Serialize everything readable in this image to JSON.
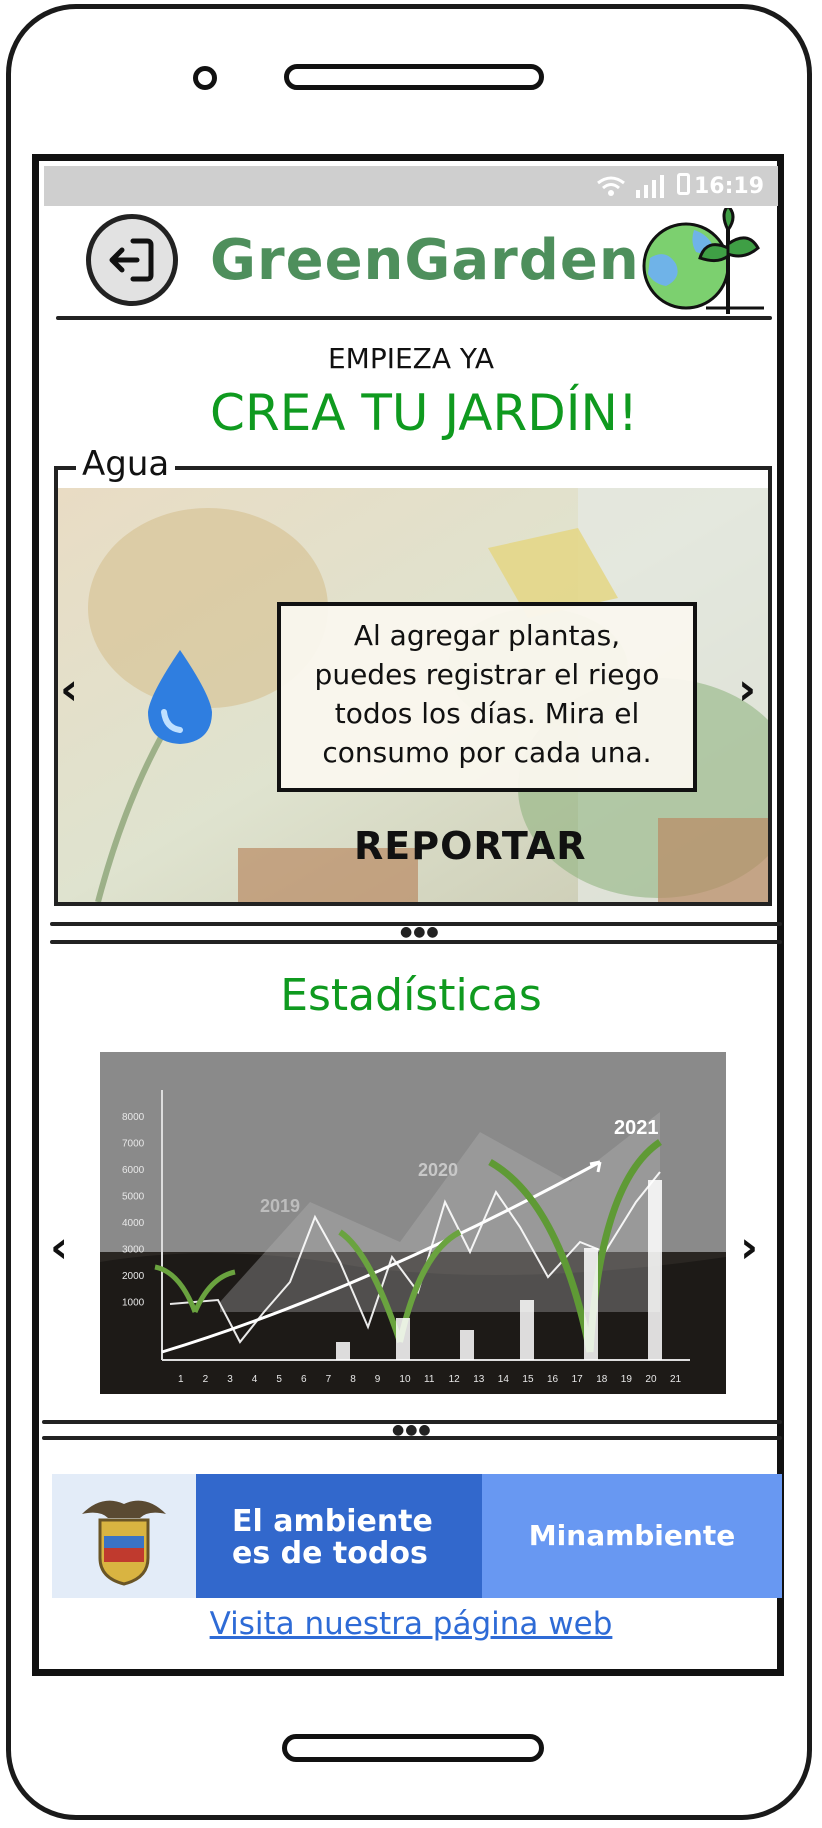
{
  "status_bar": {
    "time": "16:19"
  },
  "header": {
    "title": "GreenGarden",
    "back_icon": "logout-arrow-icon",
    "logo_icon": "earth-plant-logo"
  },
  "hero": {
    "kicker": "EMPIEZA YA",
    "headline": "CREA TU JARDÍN!"
  },
  "water_card": {
    "legend": "Agua",
    "icon": "water-drop-icon",
    "message_lines": [
      "Al agregar plantas,",
      "puedes registrar el riego",
      "todos los días. Mira el",
      "consumo por cada una."
    ],
    "action_label": "REPORTAR",
    "prev_icon": "chevron-left-icon",
    "next_icon": "chevron-right-icon"
  },
  "stats": {
    "title": "Estadísticas",
    "image_labels": {
      "years": [
        "2019",
        "2020",
        "2021"
      ],
      "y_ticks": [
        "8000",
        "7000",
        "6000",
        "5000",
        "4000",
        "3000",
        "2000",
        "1000"
      ],
      "x_ticks": [
        "1",
        "2",
        "3",
        "4",
        "5",
        "6",
        "7",
        "8",
        "9",
        "10",
        "11",
        "12",
        "13",
        "14",
        "15",
        "16",
        "17",
        "18",
        "19",
        "20",
        "21"
      ]
    }
  },
  "footer": {
    "banner_middle_lines": [
      "El ambiente",
      "es de todos"
    ],
    "banner_right": "Minambiente",
    "link": "Visita nuestra página web"
  },
  "colors": {
    "brand_green": "#4e8f5c",
    "accent_green": "#0f9a1f",
    "drop_blue": "#2f7ee0",
    "link_blue": "#2e6bd6",
    "banner_dark_blue": "#3268cc",
    "banner_light_blue": "#6898f2"
  }
}
